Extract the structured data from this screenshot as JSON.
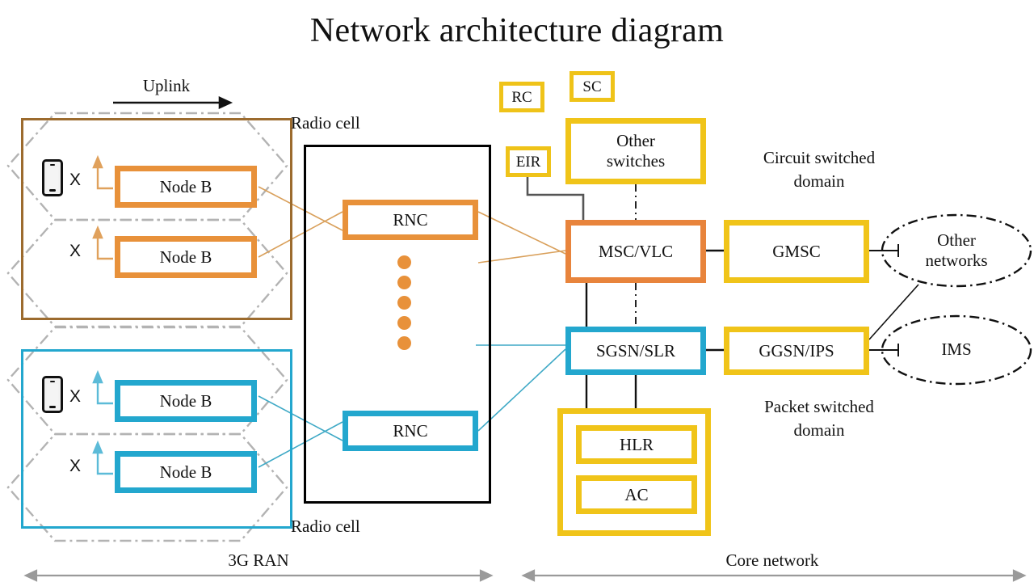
{
  "title": "Network architecture diagram",
  "colors": {
    "orange": "#E8913A",
    "orange_dark": "#E8843C",
    "teal": "#23A7CE",
    "yellow": "#F0C419",
    "brown_frame": "#9C6B2E",
    "black": "#000000",
    "grey_arrow": "#9a9a9a",
    "cell_dashdot": "#b3b3b3"
  },
  "labels": {
    "uplink": "Uplink",
    "radio_cell_top": "Radio cell",
    "radio_cell_bottom": "Radio cell",
    "ran_span": "3G RAN",
    "core_span": "Core network",
    "circuit_domain_line1": "Circuit switched",
    "circuit_domain_line2": "domain",
    "packet_domain_line1": "Packet switched",
    "packet_domain_line2": "domain",
    "x_mark": "X"
  },
  "ran": {
    "top_group": {
      "color": "#E8913A",
      "frame_color": "#9C6B2E",
      "nodes": [
        {
          "label": "Node B",
          "has_phone": true
        },
        {
          "label": "Node B",
          "has_phone": false
        }
      ]
    },
    "bottom_group": {
      "color": "#23A7CE",
      "frame_color": "#23A7CE",
      "nodes": [
        {
          "label": "Node B",
          "has_phone": true
        },
        {
          "label": "Node B",
          "has_phone": false
        }
      ]
    }
  },
  "rnc_panel": {
    "rnc_top": "RNC",
    "rnc_bottom": "RNC",
    "dots_count": 5
  },
  "core": {
    "rc": "RC",
    "sc": "SC",
    "eir": "EIR",
    "other_switches_line1": "Other",
    "other_switches_line2": "switches",
    "msc_vlc": "MSC/VLC",
    "gmsc": "GMSC",
    "sgsn_slr": "SGSN/SLR",
    "ggsn_ips": "GGSN/IPS",
    "hlr": "HLR",
    "ac": "AC",
    "other_networks_line1": "Other",
    "other_networks_line2": "networks",
    "ims": "IMS"
  }
}
